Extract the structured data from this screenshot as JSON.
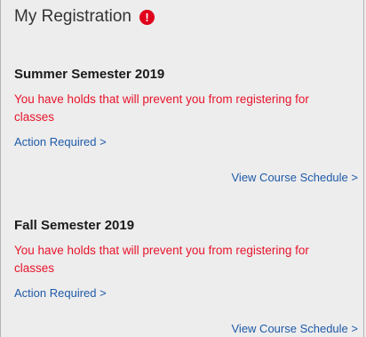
{
  "header": {
    "title": "My Registration",
    "alert_glyph": "!"
  },
  "terms": [
    {
      "title": "Summer Semester 2019",
      "hold_message": "You have holds that will prevent you from registering for classes",
      "action_label": "Action Required >",
      "schedule_label": "View Course Schedule >"
    },
    {
      "title": "Fall Semester 2019",
      "hold_message": "You have holds that will prevent you from registering for classes",
      "action_label": "Action Required >",
      "schedule_label": "View Course Schedule >"
    }
  ],
  "colors": {
    "alert": "#e0001b",
    "hold_text": "#e8142b",
    "link": "#1f5aa8",
    "background": "#ededed"
  },
  "icons": {
    "alert": "exclamation-circle-icon"
  }
}
